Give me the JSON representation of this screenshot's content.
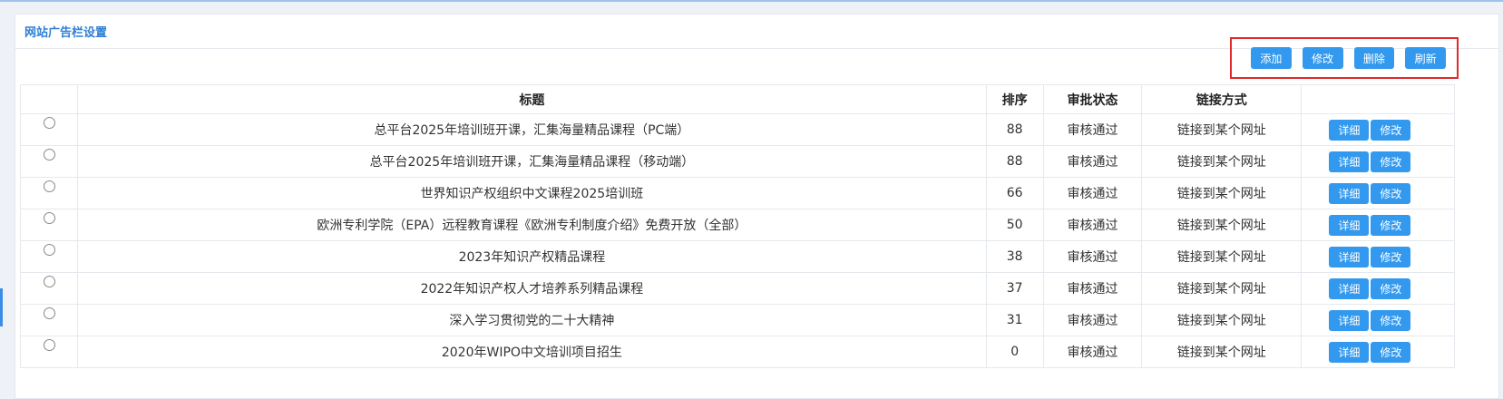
{
  "panel": {
    "title": "网站广告栏设置"
  },
  "toolbar": {
    "add_label": "添加",
    "edit_label": "修改",
    "delete_label": "删除",
    "refresh_label": "刷新"
  },
  "table": {
    "headers": {
      "title": "标题",
      "sort": "排序",
      "status": "审批状态",
      "link": "链接方式",
      "ops": ""
    },
    "row_actions": {
      "detail": "详细",
      "edit": "修改"
    },
    "rows": [
      {
        "title": "总平台2025年培训班开课，汇集海量精品课程（PC端）",
        "sort": "88",
        "status": "审核通过",
        "link": "链接到某个网址"
      },
      {
        "title": "总平台2025年培训班开课，汇集海量精品课程（移动端）",
        "sort": "88",
        "status": "审核通过",
        "link": "链接到某个网址"
      },
      {
        "title": "世界知识产权组织中文课程2025培训班",
        "sort": "66",
        "status": "审核通过",
        "link": "链接到某个网址"
      },
      {
        "title": "欧洲专利学院（EPA）远程教育课程《欧洲专利制度介绍》免费开放（全部）",
        "sort": "50",
        "status": "审核通过",
        "link": "链接到某个网址"
      },
      {
        "title": "2023年知识产权精品课程",
        "sort": "38",
        "status": "审核通过",
        "link": "链接到某个网址"
      },
      {
        "title": "2022年知识产权人才培养系列精品课程",
        "sort": "37",
        "status": "审核通过",
        "link": "链接到某个网址"
      },
      {
        "title": "深入学习贯彻党的二十大精神",
        "sort": "31",
        "status": "审核通过",
        "link": "链接到某个网址"
      },
      {
        "title": "2020年WIPO中文培训项目招生",
        "sort": "0",
        "status": "审核通过",
        "link": "链接到某个网址"
      }
    ]
  }
}
